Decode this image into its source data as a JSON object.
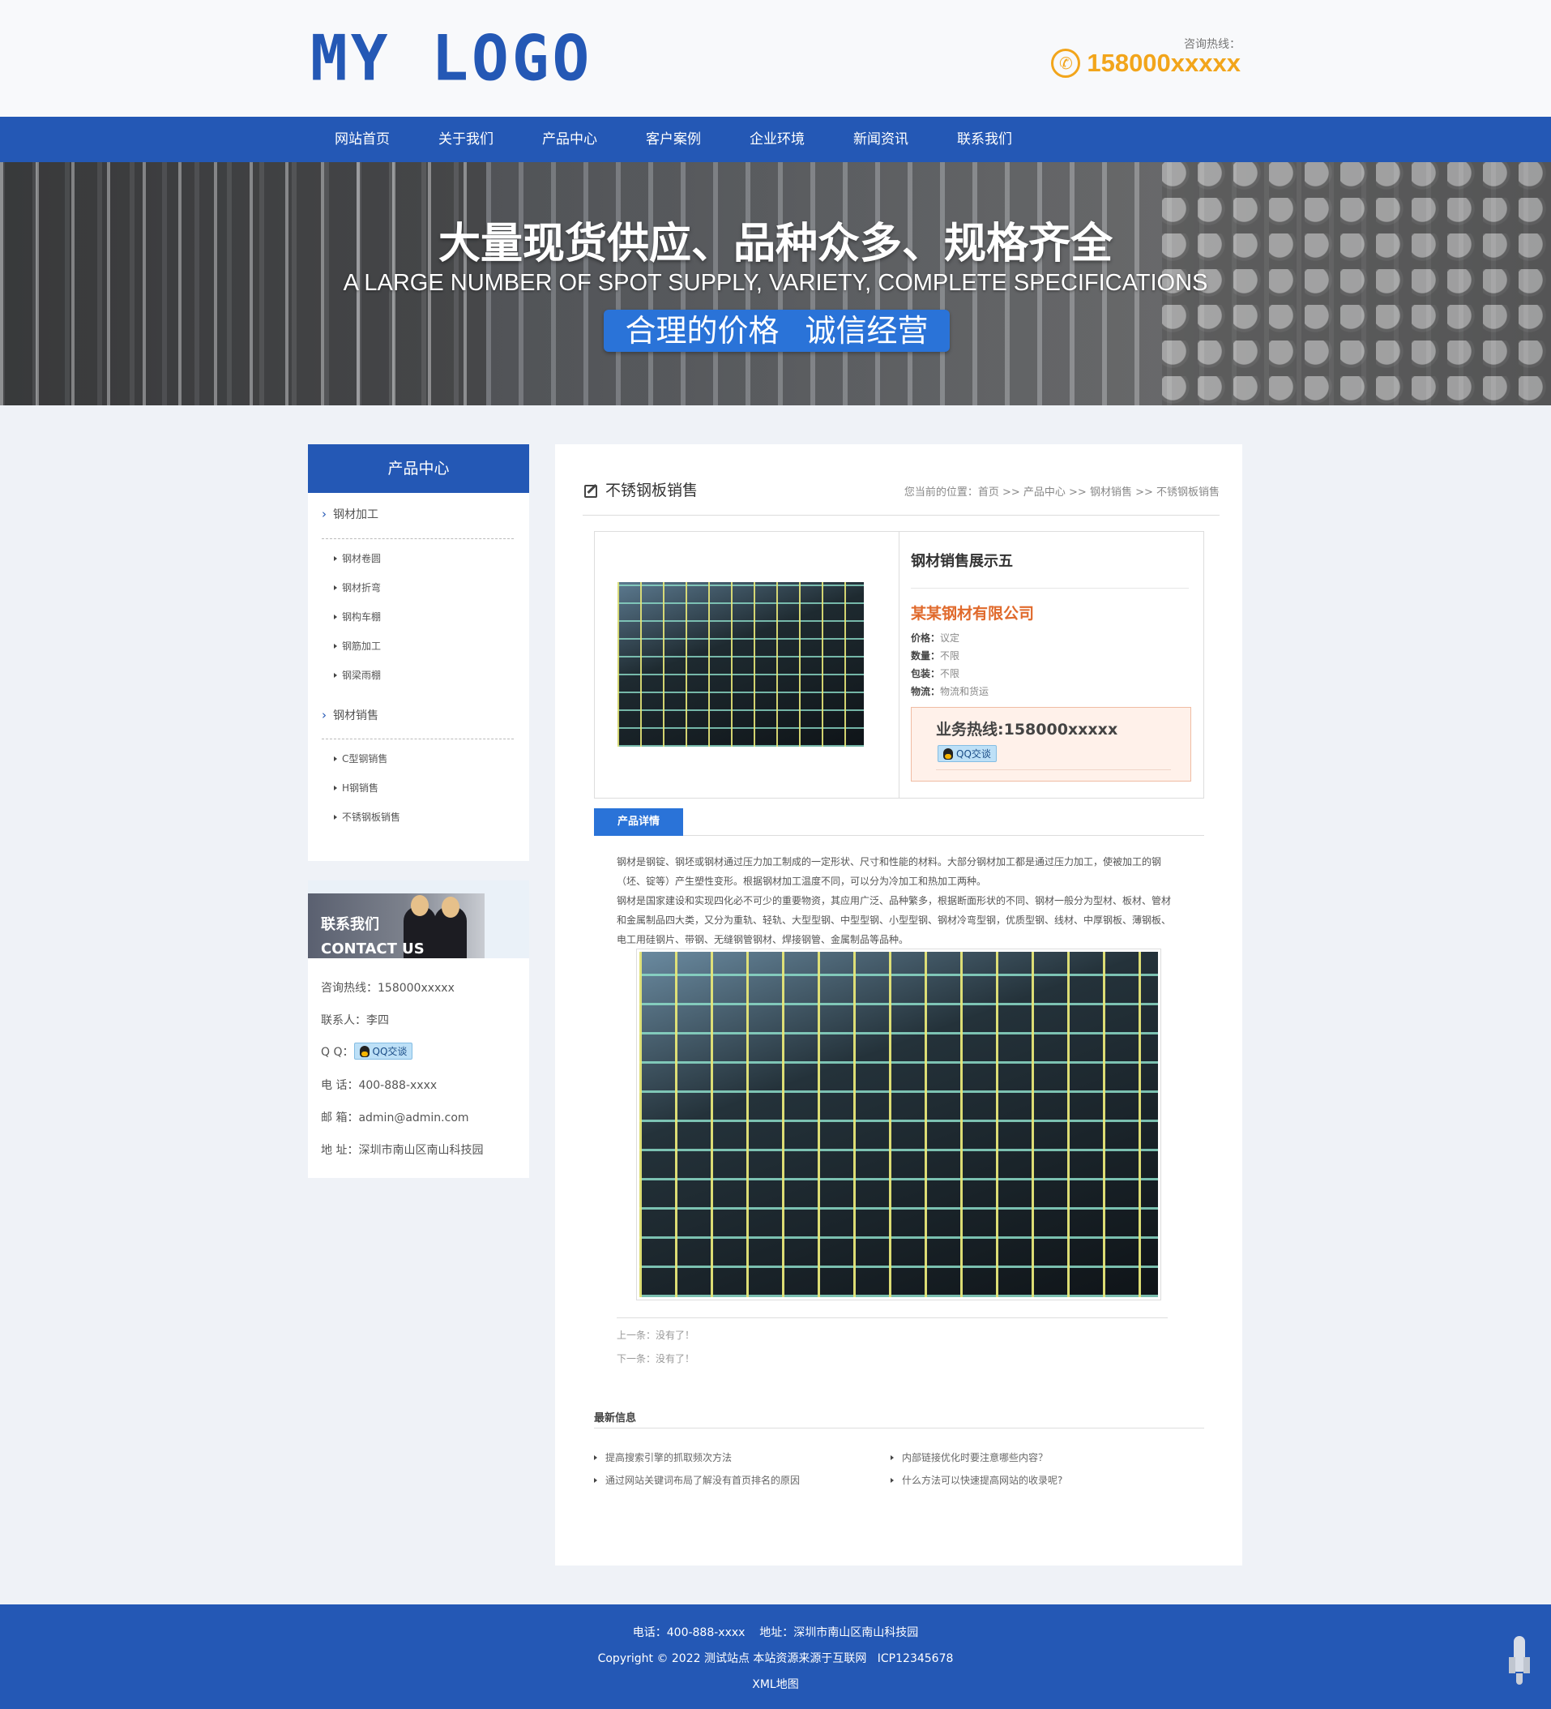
{
  "header": {
    "logo": "MY LOGO",
    "hotline_label": "咨询热线：",
    "hotline_number": "158000xxxxx",
    "phone_icon": "phone-icon"
  },
  "nav": {
    "items": [
      "网站首页",
      "关于我们",
      "产品中心",
      "客户案例",
      "企业环境",
      "新闻资讯",
      "联系我们"
    ]
  },
  "banner": {
    "title": "大量现货供应、品种众多、规格齐全",
    "subtitle": "A LARGE NUMBER OF SPOT SUPPLY, VARIETY, COMPLETE SPECIFICATIONS",
    "tag": "合理的价格 诚信经营"
  },
  "sidebar": {
    "heading": "产品中心",
    "categories": [
      {
        "label": "钢材加工",
        "children": [
          "钢材卷圆",
          "钢材折弯",
          "钢构车棚",
          "钢筋加工",
          "钢梁雨棚"
        ]
      },
      {
        "label": "钢材销售",
        "children": [
          "C型钢销售",
          "H钢销售",
          "不锈钢板销售"
        ]
      }
    ]
  },
  "contact": {
    "title_cn": "联系我们",
    "title_en": "CONTACT US",
    "hotline": "咨询热线：158000xxxxx",
    "person": "联系人：李四",
    "qq_label": "Q Q：",
    "qq_button": "QQ交谈",
    "phone": "电 话：400-888-xxxx",
    "email": "邮 箱：admin@admin.com",
    "address": "地 址：深圳市南山区南山科技园"
  },
  "main": {
    "section_title": "不锈钢板销售",
    "breadcrumb": "您当前的位置：首页 >> 产品中心 >> 钢材销售 >> 不锈钢板销售",
    "product": {
      "name": "钢材销售展示五",
      "company": "某某钢材有限公司",
      "price_label": "价格：",
      "price": "议定",
      "qty_label": "数量：",
      "qty": "不限",
      "pack_label": "包装：",
      "pack": "不限",
      "logistics_label": "物流：",
      "logistics": "物流和货运",
      "hotline": "业务热线:158000xxxxx",
      "qq_button": "QQ交谈"
    },
    "tab_label": "产品详情",
    "detail_p1": "钢材是钢锭、钢坯或钢材通过压力加工制成的一定形状、尺寸和性能的材料。大部分钢材加工都是通过压力加工，使被加工的钢（坯、锭等）产生塑性变形。根据钢材加工温度不同，可以分为冷加工和热加工两种。",
    "detail_p2": "钢材是国家建设和实现四化必不可少的重要物资，其应用广泛、品种繁多，根据断面形状的不同、钢材一般分为型材、板材、管材和金属制品四大类，又分为重轨、轻轨、大型型钢、中型型钢、小型型钢、钢材冷弯型钢，优质型钢、线材、中厚钢板、薄钢板、电工用硅钢片、带钢、无缝钢管钢材、焊接钢管、金属制品等品种。",
    "prev": "上一条：没有了！",
    "next": "下一条：没有了！",
    "latest_title": "最新信息",
    "latest": [
      "提高搜索引擎的抓取频次方法",
      "内部链接优化时要注意哪些内容？",
      "通过网站关键词布局了解没有首页排名的原因",
      "什么方法可以快速提高网站的收录呢?"
    ]
  },
  "footer": {
    "line1": "电话：400-888-xxxx    地址：深圳市南山区南山科技园",
    "line2": "Copyright © 2022 测试站点 本站资源来源于互联网   ICP12345678",
    "line3": "XML地图"
  },
  "colors": {
    "brand_blue": "#2458b5",
    "accent_orange": "#f2a51b",
    "company_orange": "#e06a2c",
    "tab_blue": "#2a73d8"
  }
}
